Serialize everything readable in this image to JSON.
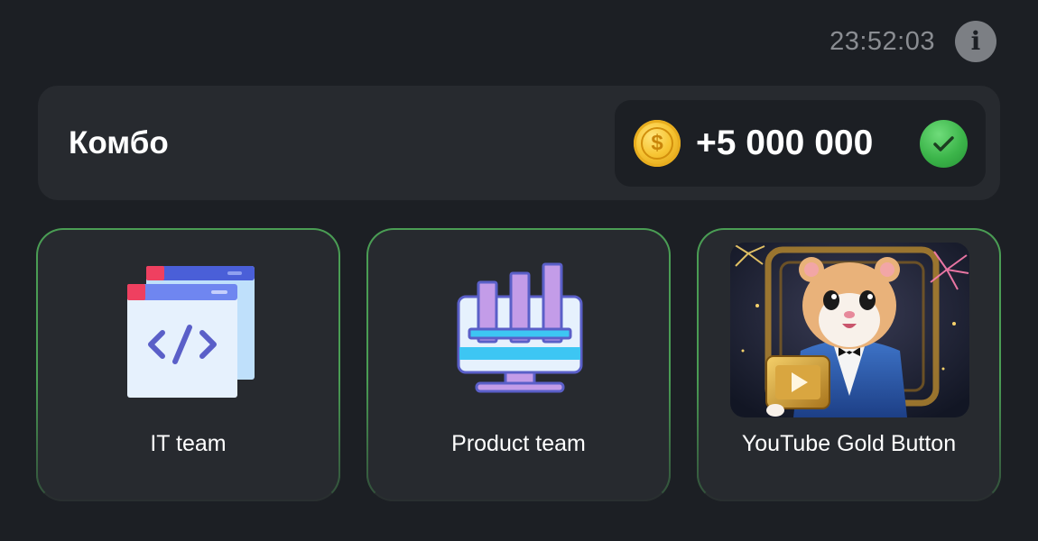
{
  "header": {
    "timer": "23:52:03",
    "info_icon": "info-icon"
  },
  "combo": {
    "title": "Комбо",
    "reward": "+5 000 000",
    "coin_icon": "coin-icon",
    "coin_symbol": "$",
    "status_icon": "check-icon"
  },
  "cards": [
    {
      "label": "IT team",
      "icon": "code-windows-icon"
    },
    {
      "label": "Product team",
      "icon": "chart-monitor-icon"
    },
    {
      "label": "YouTube Gold Button",
      "icon": "hamster-gold-button-image"
    }
  ],
  "colors": {
    "background": "#1c1f24",
    "panel": "#272a2f",
    "card_border": "#4a9d54",
    "coin": "#f7c533",
    "check": "#3cb54a",
    "muted_text": "#8a8d92"
  }
}
